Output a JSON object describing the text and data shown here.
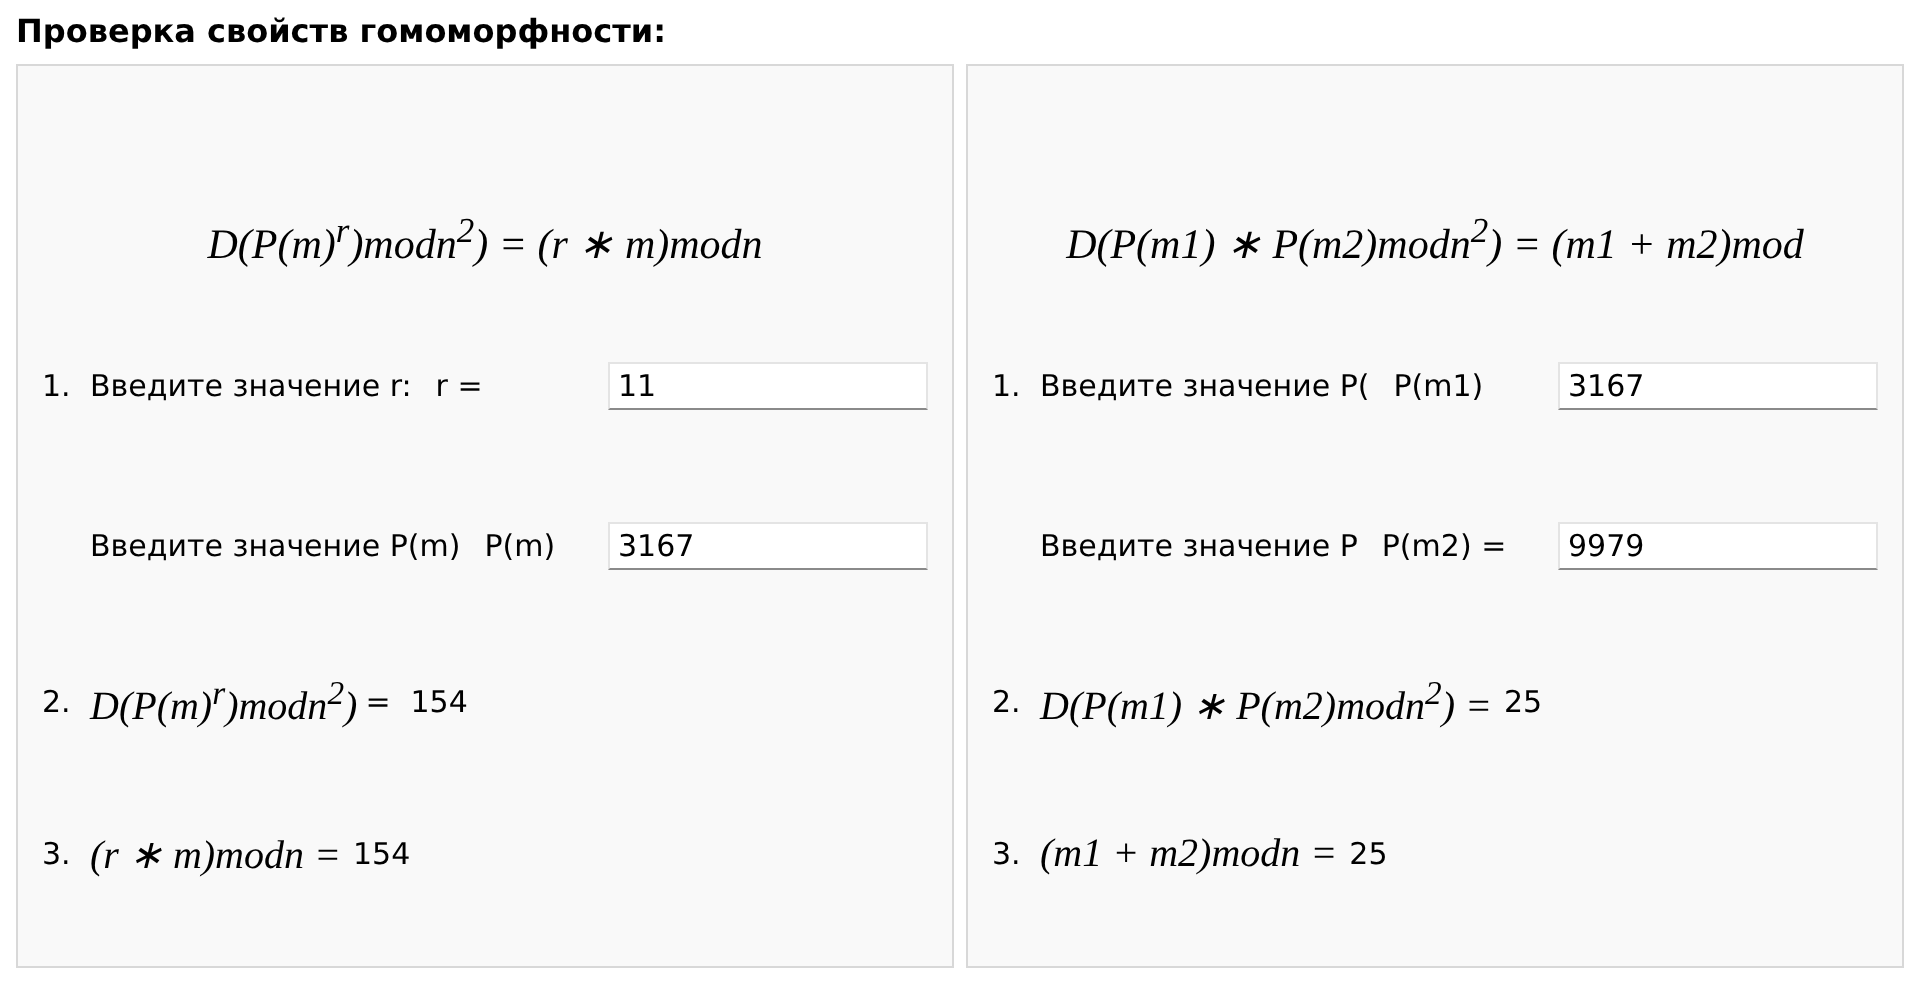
{
  "title": "Проверка свойств гомоморфности:",
  "panels": [
    {
      "formula": "D(P(m)$^{r}$)modn$^{2}$) = (r ∗ m)modn",
      "inputs": [
        {
          "number": "1.",
          "label": "Введите значение r:",
          "prefix": "r =",
          "value": "11"
        },
        {
          "label": "Введите значение P(m)",
          "prefix": "P(m)",
          "value": "3167"
        }
      ],
      "results": [
        {
          "number": "2.",
          "formula": "D(P(m)$^{r}$)modn$^{2}$)",
          "equals": "=",
          "value": "154"
        },
        {
          "number": "3.",
          "formula": "(r ∗ m)modn =",
          "value": "154"
        }
      ]
    },
    {
      "formula": "D(P(m1) ∗ P(m2)modn$^{2}$) = (m1 + m2)mod",
      "inputs": [
        {
          "number": "1.",
          "label": "Введите значение P(",
          "prefix": "P(m1)",
          "value": "3167"
        },
        {
          "label": "Введите значение P",
          "prefix": "P(m2) =",
          "value": "9979"
        }
      ],
      "results": [
        {
          "number": "2.",
          "formula": "D(P(m1) ∗ P(m2)modn$^{2}$) =",
          "value": "25"
        },
        {
          "number": "3.",
          "formula": "(m1 + m2)modn =",
          "value": "25"
        }
      ]
    }
  ]
}
